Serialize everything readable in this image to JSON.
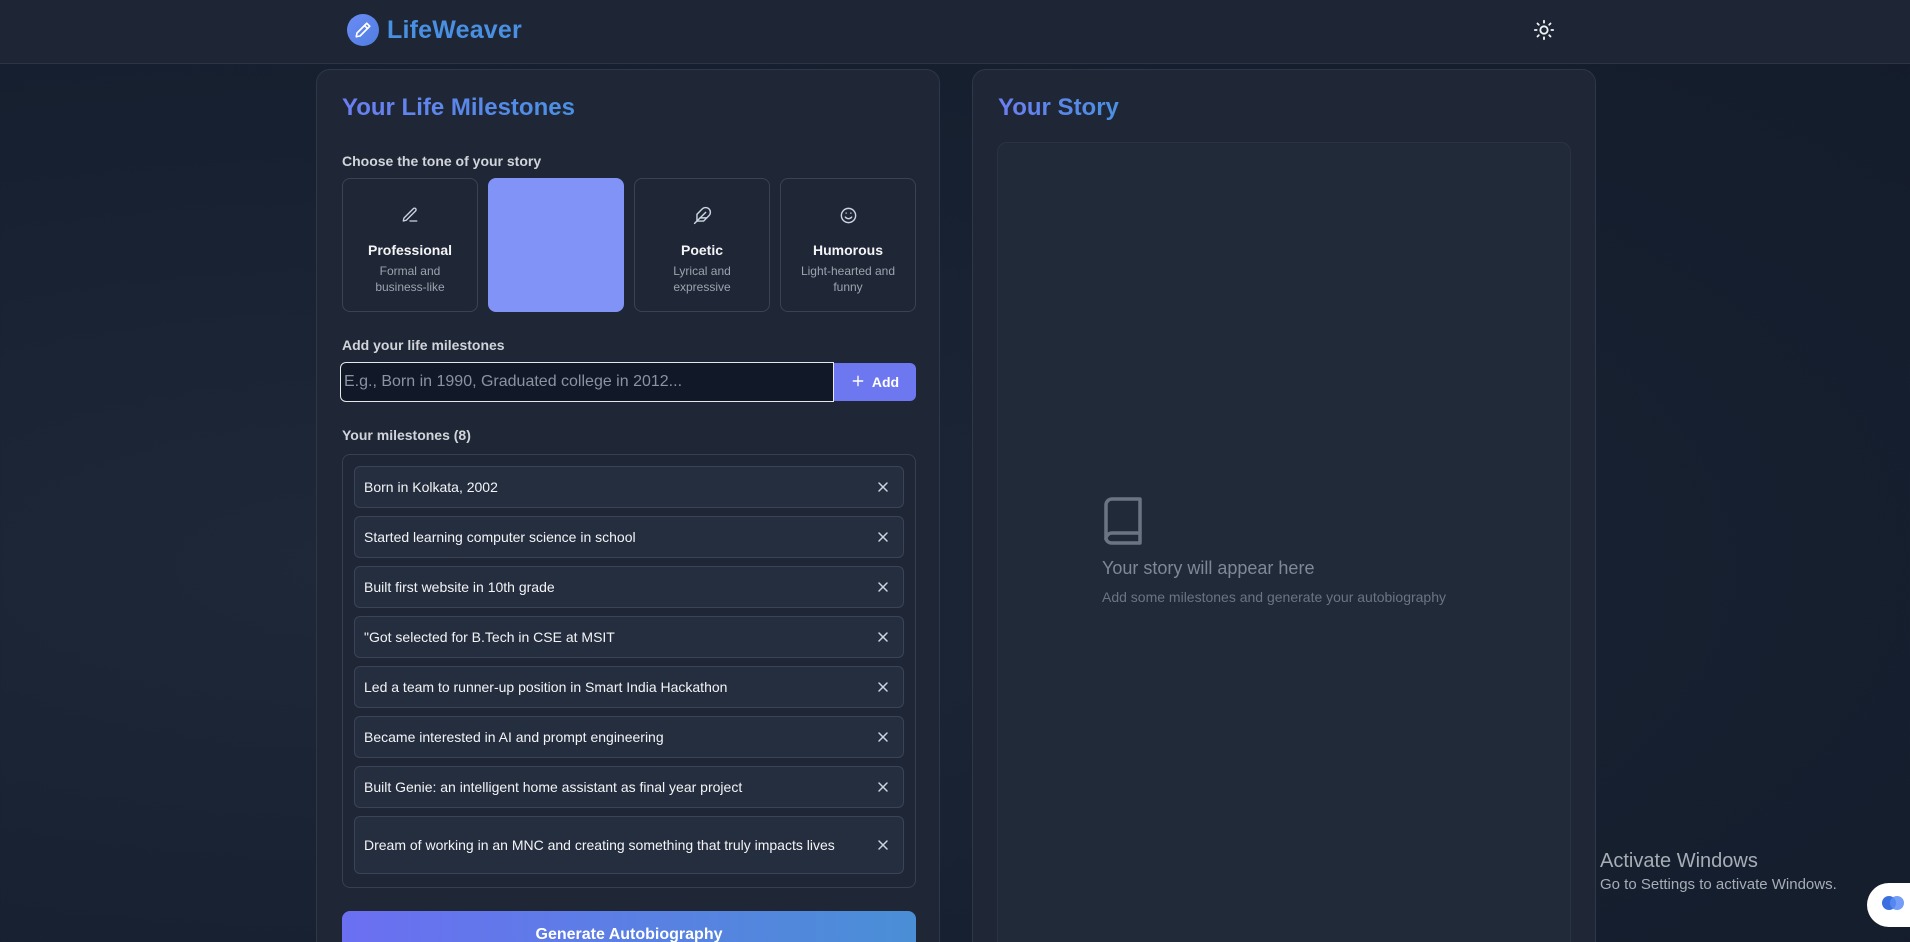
{
  "header": {
    "logo_text": "LifeWeaver",
    "logo_icon": "pencil-icon",
    "theme_icon": "sun-icon"
  },
  "left": {
    "title": "Your Life Milestones",
    "tone_label": "Choose the tone of your story",
    "tones": [
      {
        "name": "Professional",
        "desc": "Formal and business-like",
        "icon": "pen-icon",
        "selected": false
      },
      {
        "name": "",
        "desc": "",
        "icon": "",
        "selected": true
      },
      {
        "name": "Poetic",
        "desc": "Lyrical and expressive",
        "icon": "feather-icon",
        "selected": false
      },
      {
        "name": "Humorous",
        "desc": "Light-hearted and funny",
        "icon": "smile-icon",
        "selected": false
      }
    ],
    "add_label": "Add your life milestones",
    "input_placeholder": "E.g., Born in 1990, Graduated college in 2012...",
    "input_value": "",
    "add_button": "Add",
    "milestones_label": "Your milestones (8)",
    "milestones": [
      "Born in Kolkata, 2002",
      "Started learning computer science in school",
      "Built first website in 10th grade",
      "\"Got selected for B.Tech in CSE at MSIT",
      "Led a team to runner-up position in Smart India Hackathon",
      "Became interested in AI and prompt engineering",
      "Built Genie: an intelligent home assistant as final year project",
      "Dream of working in an MNC and creating something that truly impacts lives"
    ],
    "generate_button": "Generate Autobiography"
  },
  "right": {
    "title": "Your Story",
    "empty_icon": "book-icon",
    "empty_title": "Your story will appear here",
    "empty_subtitle": "Add some milestones and generate your autobiography"
  },
  "watermark": {
    "title": "Activate Windows",
    "subtitle": "Go to Settings to activate Windows."
  },
  "colors": {
    "accent": "#6d78f0",
    "selected_tone": "#8293f7",
    "brand_blue": "#4a90e2"
  }
}
